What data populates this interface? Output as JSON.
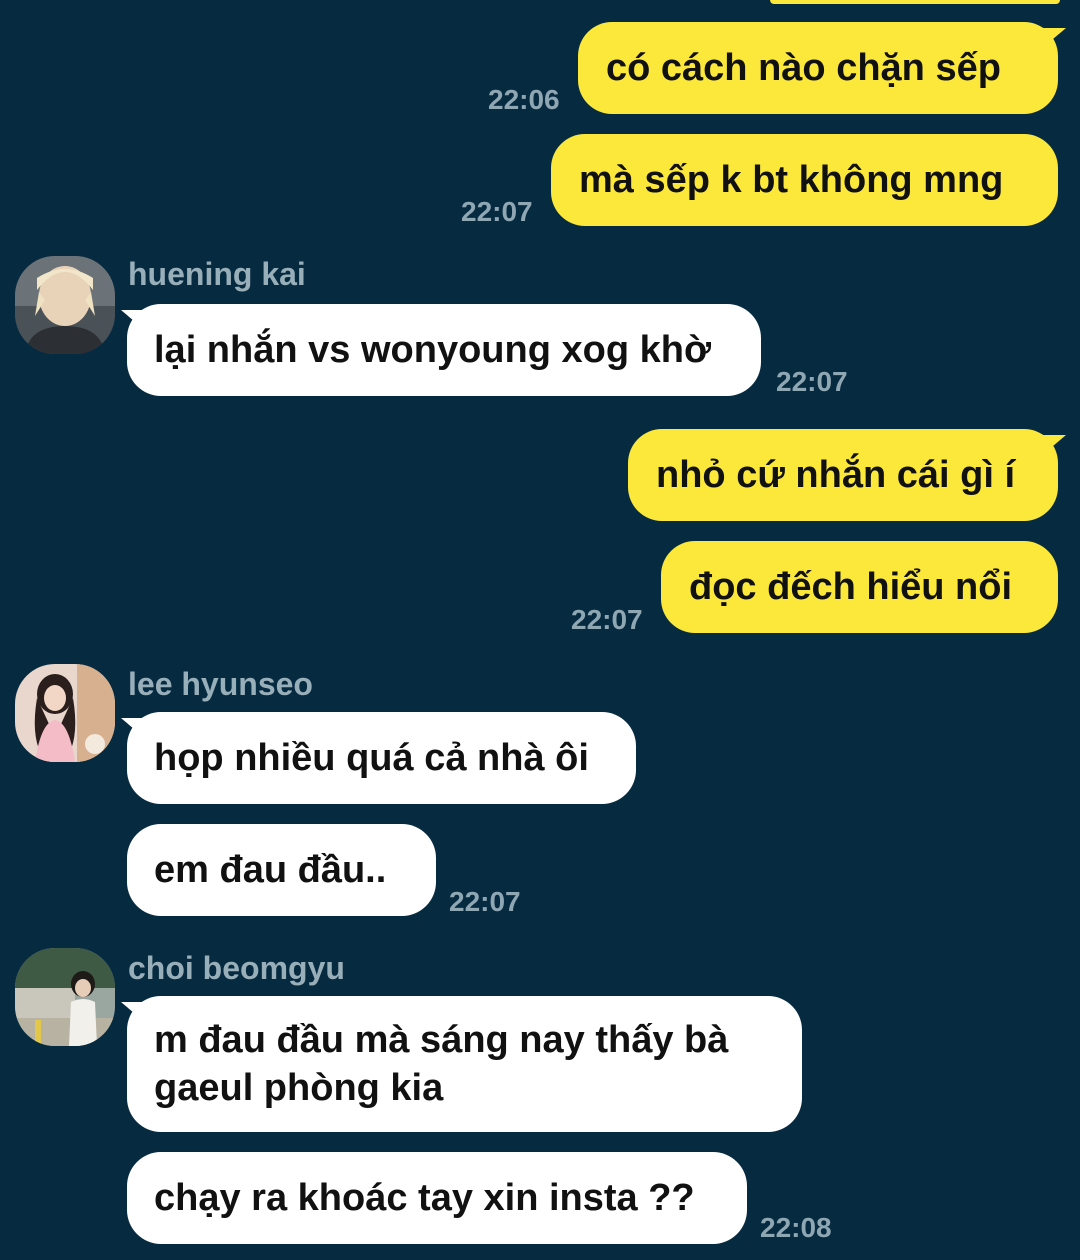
{
  "messages": [
    {
      "text": "có cách nào chặn sếp"
    },
    {
      "text": "mà sếp k bt không mng"
    },
    {
      "text": "lại nhắn vs wonyoung xog khờ"
    },
    {
      "text": "nhỏ cứ nhắn cái gì í"
    },
    {
      "text": "đọc đếch hiểu nổi"
    },
    {
      "text": "họp nhiều quá cả nhà ôi"
    },
    {
      "text": "em đau đầu.."
    },
    {
      "text": "m đau đầu mà sáng nay thấy bà gaeul phòng kia"
    },
    {
      "text": "chạy ra khoác tay xin insta ??"
    }
  ],
  "senders": {
    "kai": "huening kai",
    "hyunseo": "lee hyunseo",
    "beomgyu": "choi beomgyu"
  },
  "times": {
    "t1": "22:06",
    "t2": "22:07",
    "t3": "22:07",
    "t4": "22:07",
    "t5": "22:07",
    "t6": "22:08"
  },
  "colors": {
    "background": "#062a40",
    "outgoing_bubble": "#fbe83a",
    "incoming_bubble": "#ffffff",
    "meta_text": "#8fa6b3"
  }
}
